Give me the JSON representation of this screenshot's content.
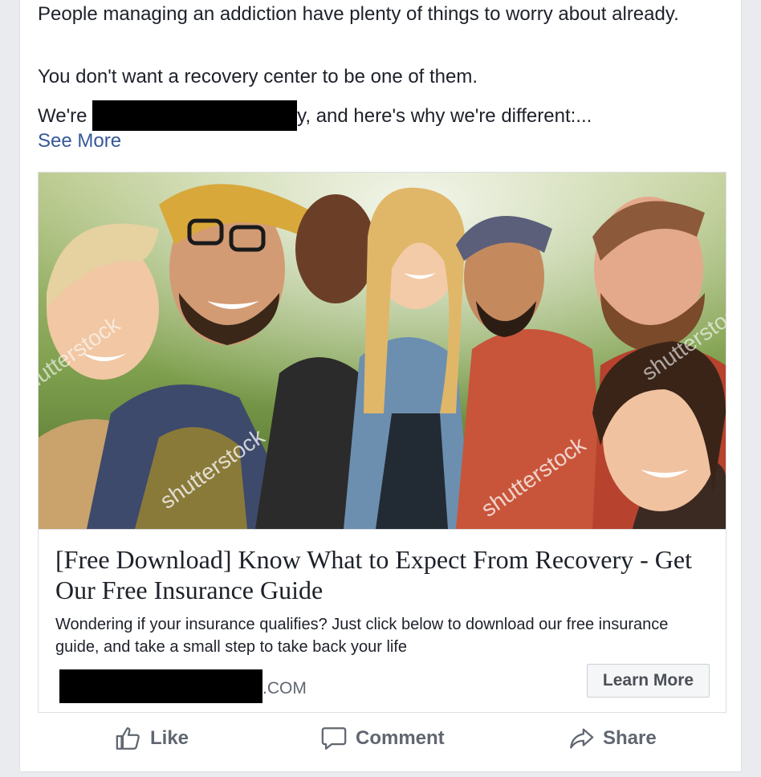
{
  "post": {
    "line1": "People managing an addiction have plenty of things to worry about already.",
    "line2": "You don't want a recovery center to be one of them.",
    "line3_prefix": "We're ",
    "line3_suffix": "y, and here's why we're different:...",
    "see_more": "See More"
  },
  "link": {
    "headline": "[Free Download] Know What to Expect From Recovery - Get Our Free Insurance Guide",
    "description": "Wondering if your insurance qualifies? Just click below to download our free insurance guide, and take a small step to take back your life",
    "domain_suffix": ".COM",
    "cta": "Learn More",
    "image_watermark": "shutterstock"
  },
  "actions": {
    "like": "Like",
    "comment": "Comment",
    "share": "Share"
  },
  "colors": {
    "link_blue": "#365899",
    "text": "#1d2129",
    "muted": "#606770",
    "background": "#e9ebee"
  }
}
